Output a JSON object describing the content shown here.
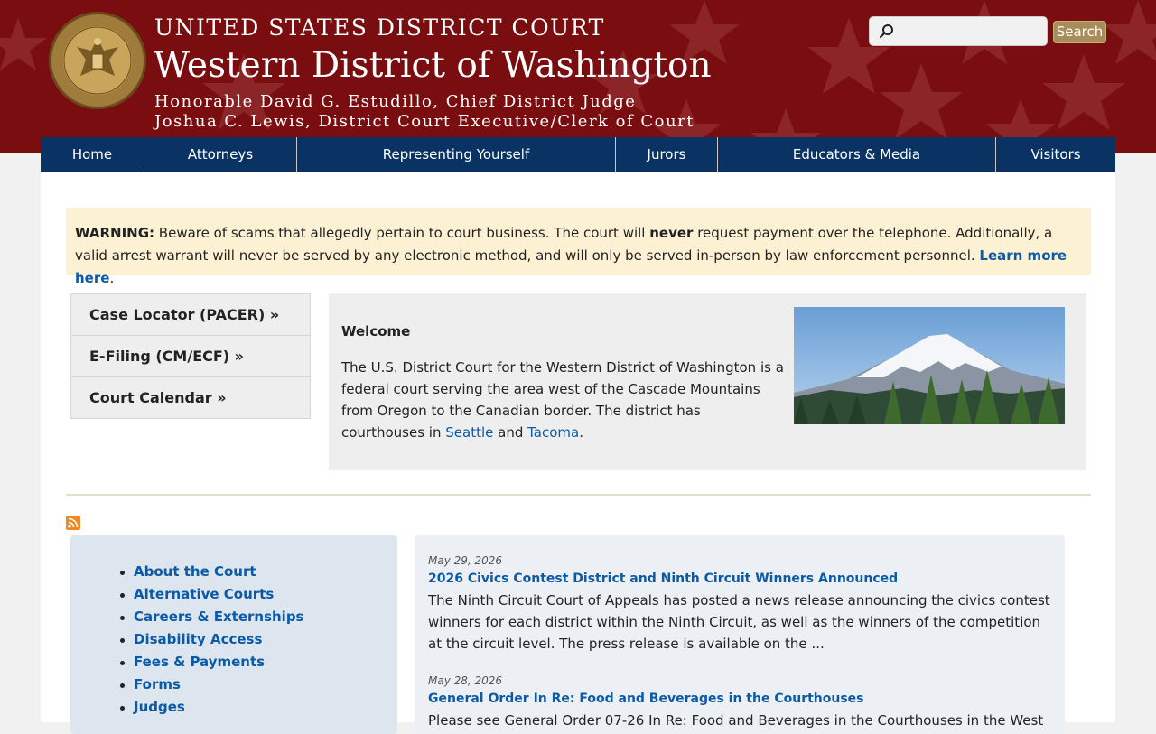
{
  "header": {
    "court_name": "UNITED STATES DISTRICT COURT",
    "district_name": "Western District of Washington",
    "chief_judge": "Honorable David G. Estudillo, Chief District Judge",
    "clerk": "Joshua C. Lewis, District Court Executive/Clerk of Court",
    "search_placeholder": "",
    "search_button": "Search",
    "colors": {
      "banner": "#7a0d0f",
      "nav": "#0a3363",
      "gold": "#a88c5a"
    }
  },
  "nav": {
    "items": [
      {
        "label": "Home"
      },
      {
        "label": "Attorneys"
      },
      {
        "label": "Representing Yourself"
      },
      {
        "label": "Jurors"
      },
      {
        "label": "Educators & Media"
      },
      {
        "label": "Visitors"
      }
    ]
  },
  "warning": {
    "label": "WARNING:",
    "text_1": " Beware of scams that allegedly pertain to court business. The court will ",
    "emphasis": "never",
    "text_2": " request payment over the telephone. Additionally, a valid arrest warrant will never be served by any electronic method, and will only be served in-person by law enforcement personnel. ",
    "link": "Learn more here",
    "end": "."
  },
  "quick_links": [
    {
      "label": "Case Locator (PACER) »"
    },
    {
      "label": "E-Filing (CM/ECF) »"
    },
    {
      "label": "Court Calendar »"
    }
  ],
  "welcome": {
    "title": "Welcome",
    "text": "The U.S. District Court for the Western District of Washington is a federal court serving the area west of the Cascade Mountains from Oregon to the Canadian border. The district has courthouses in ",
    "link_1": "Seattle",
    "and": " and ",
    "link_2": "Tacoma",
    "end": "."
  },
  "sidebar": {
    "items": [
      {
        "label": "About the Court"
      },
      {
        "label": "Alternative Courts"
      },
      {
        "label": "Careers & Externships"
      },
      {
        "label": "Disability Access"
      },
      {
        "label": "Fees & Payments"
      },
      {
        "label": "Forms"
      },
      {
        "label": "Judges"
      }
    ]
  },
  "news": {
    "items": [
      {
        "date": "May 29, 2026",
        "title": "2026 Civics Contest District and Ninth Circuit Winners Announced",
        "body": "The Ninth Circuit Court of Appeals has posted a news release announcing the civics contest winners for each district within the Ninth Circuit, as well as the winners of the competition at the circuit level.  The press release is available on the ..."
      },
      {
        "date": "May 28, 2026",
        "title": "General Order In Re: Food and Beverages in the Courthouses",
        "body": "Please see General Order 07-26 In Re: Food and Beverages in the Courthouses in the West"
      }
    ]
  }
}
